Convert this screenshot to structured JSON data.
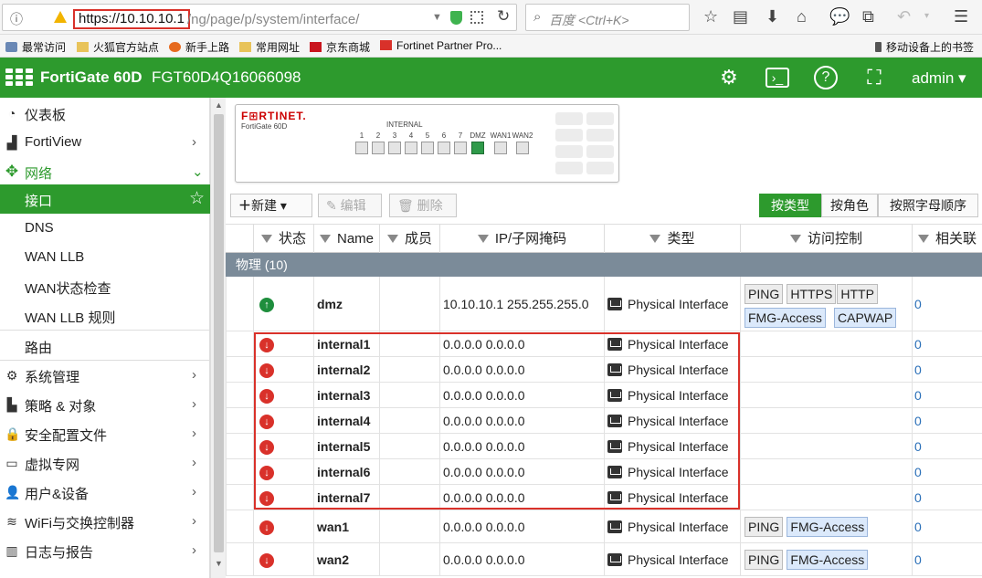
{
  "browser": {
    "url_host": "https://10.10.10.1",
    "url_path": "/ng/page/p/system/interface/",
    "search_placeholder": "百度 <Ctrl+K>"
  },
  "bookmarks": [
    {
      "label": "最常访问",
      "icon": "gear-icon"
    },
    {
      "label": "火狐官方站点",
      "icon": "folder-icon"
    },
    {
      "label": "新手上路",
      "icon": "firefox-icon"
    },
    {
      "label": "常用网址",
      "icon": "folder-icon"
    },
    {
      "label": "京东商城",
      "icon": "jd-icon"
    },
    {
      "label": "Fortinet Partner Pro...",
      "icon": "fortinet-icon"
    },
    {
      "label": "移动设备上的书签",
      "icon": "mobile-icon"
    }
  ],
  "app": {
    "model": "FortiGate 60D",
    "serial": "FGT60D4Q16066098",
    "user": "admin"
  },
  "sidebar": {
    "items": [
      {
        "label": "仪表板",
        "icon": "dashboard-icon"
      },
      {
        "label": "FortiView",
        "icon": "chart-icon",
        "chevron": "›"
      },
      {
        "label": "网络",
        "icon": "move-icon",
        "chevron": "⌄"
      },
      {
        "label": "接口",
        "icon": "star-icon"
      },
      {
        "label": "DNS"
      },
      {
        "label": "WAN LLB"
      },
      {
        "label": "WAN状态检查"
      },
      {
        "label": "WAN LLB 规则"
      },
      {
        "label": "路由"
      },
      {
        "label": "系统管理",
        "icon": "gear-icon",
        "chevron": "›"
      },
      {
        "label": "策略 & 对象",
        "icon": "policy-icon",
        "chevron": "›"
      },
      {
        "label": "安全配置文件",
        "icon": "lock-icon",
        "chevron": "›"
      },
      {
        "label": "虚拟专网",
        "icon": "laptop-icon",
        "chevron": "›"
      },
      {
        "label": "用户&设备",
        "icon": "user-icon",
        "chevron": "›"
      },
      {
        "label": "WiFi与交换控制器",
        "icon": "wifi-icon",
        "chevron": "›"
      },
      {
        "label": "日志与报告",
        "icon": "report-icon",
        "chevron": "›"
      }
    ]
  },
  "device": {
    "brand": "F⊞RTINET.",
    "model": "FortiGate 60D",
    "internal_label": "INTERNAL",
    "ports": [
      {
        "label": "1",
        "up": false
      },
      {
        "label": "2",
        "up": false
      },
      {
        "label": "3",
        "up": false
      },
      {
        "label": "4",
        "up": false
      },
      {
        "label": "5",
        "up": false
      },
      {
        "label": "6",
        "up": false
      },
      {
        "label": "7",
        "up": false
      },
      {
        "label": "DMZ",
        "up": true
      },
      {
        "label": "WAN1",
        "up": false
      },
      {
        "label": "WAN2",
        "up": false
      }
    ]
  },
  "toolbar": {
    "new_label": "新建",
    "edit_label": "编辑",
    "delete_label": "删除",
    "views": [
      {
        "label": "按类型",
        "active": true
      },
      {
        "label": "按角色",
        "active": false
      },
      {
        "label": "按照字母顺序",
        "active": false
      }
    ]
  },
  "table": {
    "columns": [
      "状态",
      "Name",
      "成员",
      "IP/子网掩码",
      "类型",
      "访问控制",
      "相关联"
    ],
    "group_label": "物理 (10)",
    "rows": [
      {
        "status": "up",
        "name": "dmz",
        "ip": "10.10.10.1 255.255.255.0",
        "type": "Physical Interface",
        "access": [
          "PING",
          "HTTPS",
          "HTTP",
          "FMG-Access",
          "CAPWAP"
        ],
        "refs": "0"
      },
      {
        "status": "down",
        "name": "internal1",
        "ip": "0.0.0.0 0.0.0.0",
        "type": "Physical Interface",
        "access": [],
        "refs": "0"
      },
      {
        "status": "down",
        "name": "internal2",
        "ip": "0.0.0.0 0.0.0.0",
        "type": "Physical Interface",
        "access": [],
        "refs": "0"
      },
      {
        "status": "down",
        "name": "internal3",
        "ip": "0.0.0.0 0.0.0.0",
        "type": "Physical Interface",
        "access": [],
        "refs": "0"
      },
      {
        "status": "down",
        "name": "internal4",
        "ip": "0.0.0.0 0.0.0.0",
        "type": "Physical Interface",
        "access": [],
        "refs": "0"
      },
      {
        "status": "down",
        "name": "internal5",
        "ip": "0.0.0.0 0.0.0.0",
        "type": "Physical Interface",
        "access": [],
        "refs": "0"
      },
      {
        "status": "down",
        "name": "internal6",
        "ip": "0.0.0.0 0.0.0.0",
        "type": "Physical Interface",
        "access": [],
        "refs": "0"
      },
      {
        "status": "down",
        "name": "internal7",
        "ip": "0.0.0.0 0.0.0.0",
        "type": "Physical Interface",
        "access": [],
        "refs": "0"
      },
      {
        "status": "down",
        "name": "wan1",
        "ip": "0.0.0.0 0.0.0.0",
        "type": "Physical Interface",
        "access": [
          "PING",
          "FMG-Access"
        ],
        "refs": "0"
      },
      {
        "status": "down",
        "name": "wan2",
        "ip": "0.0.0.0 0.0.0.0",
        "type": "Physical Interface",
        "access": [
          "PING",
          "FMG-Access"
        ],
        "refs": "0"
      }
    ]
  },
  "colors": {
    "brand_green": "#2d9a2d",
    "status_up": "#1f8e3d",
    "status_down": "#d9312a",
    "group_header": "#7b8b99",
    "highlight": "#d9312a"
  }
}
